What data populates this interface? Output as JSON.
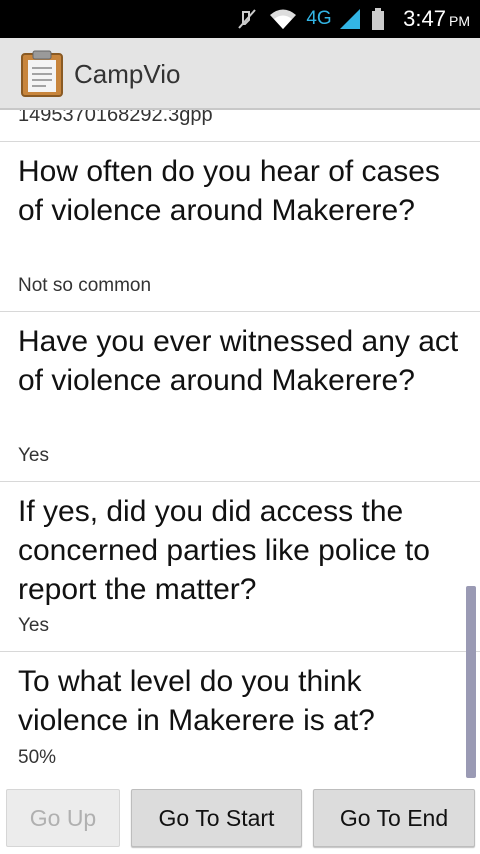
{
  "status_bar": {
    "time": "3:47",
    "ampm": "PM",
    "network": "4G",
    "icons": [
      "mute-icon",
      "wifi-icon",
      "signal-icon",
      "battery-icon"
    ]
  },
  "app": {
    "title": "CampVio",
    "icon": "clipboard-icon"
  },
  "list": {
    "cut_text": "1495370168292.3gpp",
    "items": [
      {
        "question": "How often do you hear of cases of violence around Makerere?",
        "answer": "Not so common"
      },
      {
        "question": "Have you ever witnessed any act of violence around Makerere?",
        "answer": "Yes"
      },
      {
        "question": "If yes, did you did access the concerned parties like police to report the matter?",
        "answer": "Yes"
      },
      {
        "question": "To what level do you think violence in Makerere is at?",
        "answer": "50%"
      }
    ]
  },
  "buttons": {
    "go_up": "Go Up",
    "go_to_start": "Go To Start",
    "go_to_end": "Go To End"
  },
  "colors": {
    "network_accent": "#33b5e5",
    "scrollbar": "#9a9ab4"
  }
}
